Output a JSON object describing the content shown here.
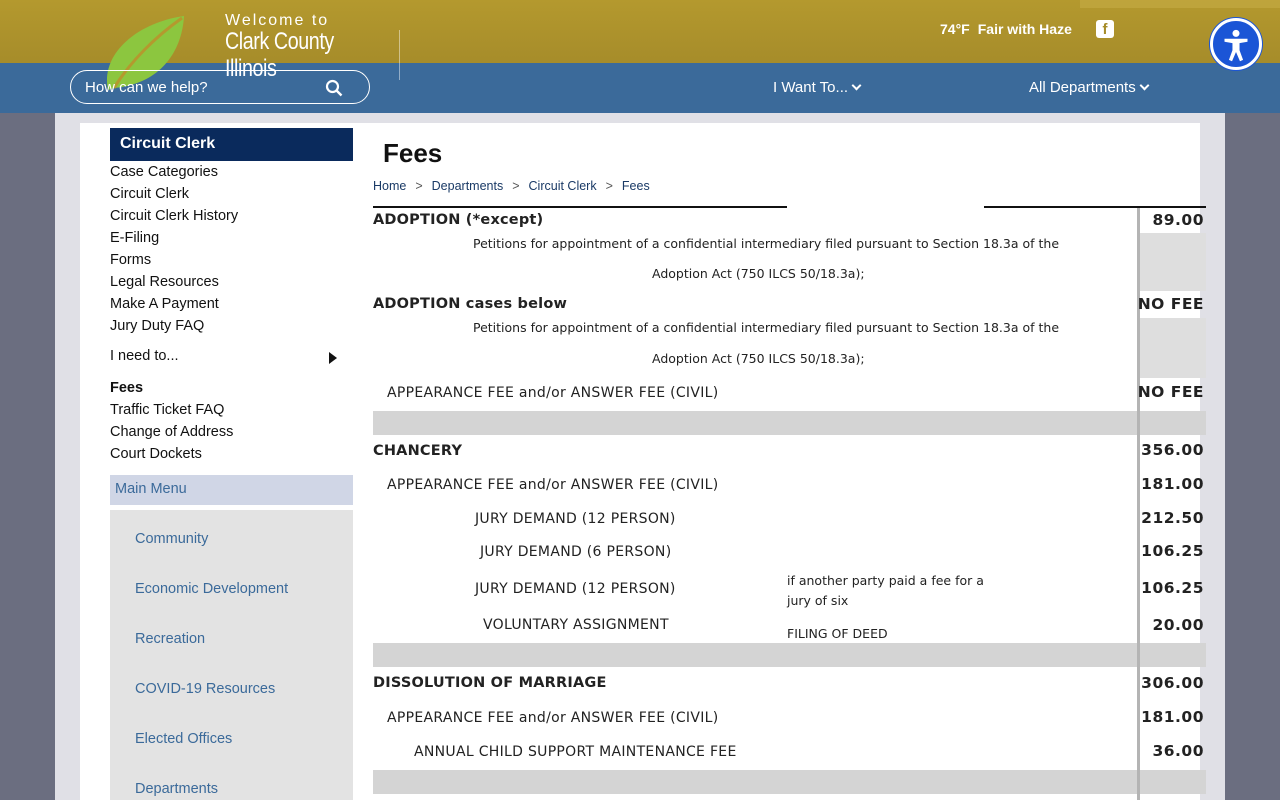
{
  "header": {
    "welcome": "Welcome to",
    "county_line1": "Clark County",
    "county_line2": "Illinois",
    "temperature": "74°F",
    "conditions": "Fair with Haze",
    "facebook_glyph": "f"
  },
  "nav": {
    "search_placeholder": "How can we help?",
    "i_want_to": "I Want To...",
    "all_departments": "All Departments"
  },
  "sidebar": {
    "title": "Circuit Clerk",
    "items": [
      "Case Categories",
      "Circuit Clerk",
      "Circuit Clerk History",
      "E-Filing",
      "Forms",
      "Legal Resources",
      "Make A Payment",
      "Jury Duty FAQ"
    ],
    "need_to": "I need to...",
    "items2": [
      "Fees",
      "Traffic Ticket FAQ",
      "Change of Address",
      "Court Dockets"
    ],
    "main_menu": "Main Menu",
    "menu_items": [
      "Community",
      "Economic Development",
      "Recreation",
      "COVID-19 Resources",
      "Elected Offices",
      "Departments"
    ]
  },
  "main": {
    "title": "Fees",
    "breadcrumb": [
      "Home",
      "Departments",
      "Circuit Clerk",
      "Fees"
    ],
    "adoption_except": "ADOPTION (*except)",
    "adoption_except_amt": "89.00",
    "petition_line1": "Petitions for appointment of a confidential intermediary filed pursuant to Section 18.3a of the",
    "petition_line2": "Adoption Act (750 ILCS 50/18.3a);",
    "adoption_below": "ADOPTION cases below",
    "no_fee": "NO FEE",
    "appearance": "APPEARANCE FEE and/or ANSWER FEE (CIVIL)",
    "chancery": "CHANCERY",
    "chancery_amt": "356.00",
    "chancery_appearance_amt": "181.00",
    "jury12": "JURY DEMAND (12 PERSON)",
    "jury12_amt": "212.50",
    "jury6": "JURY DEMAND (6 PERSON)",
    "jury6_amt": "106.25",
    "jury12b_amt": "106.25",
    "jury12b_note1": "if another party paid a fee for a",
    "jury12b_note2": "jury of six",
    "voluntary": "VOLUNTARY ASSIGNMENT",
    "voluntary_note": "FILING OF DEED",
    "voluntary_amt": "20.00",
    "dissolution": "DISSOLUTION OF MARRIAGE",
    "dissolution_amt": "306.00",
    "dissolution_appearance_amt": "181.00",
    "child_support": "ANNUAL CHILD SUPPORT MAINTENANCE FEE",
    "child_support_amt": "36.00"
  }
}
